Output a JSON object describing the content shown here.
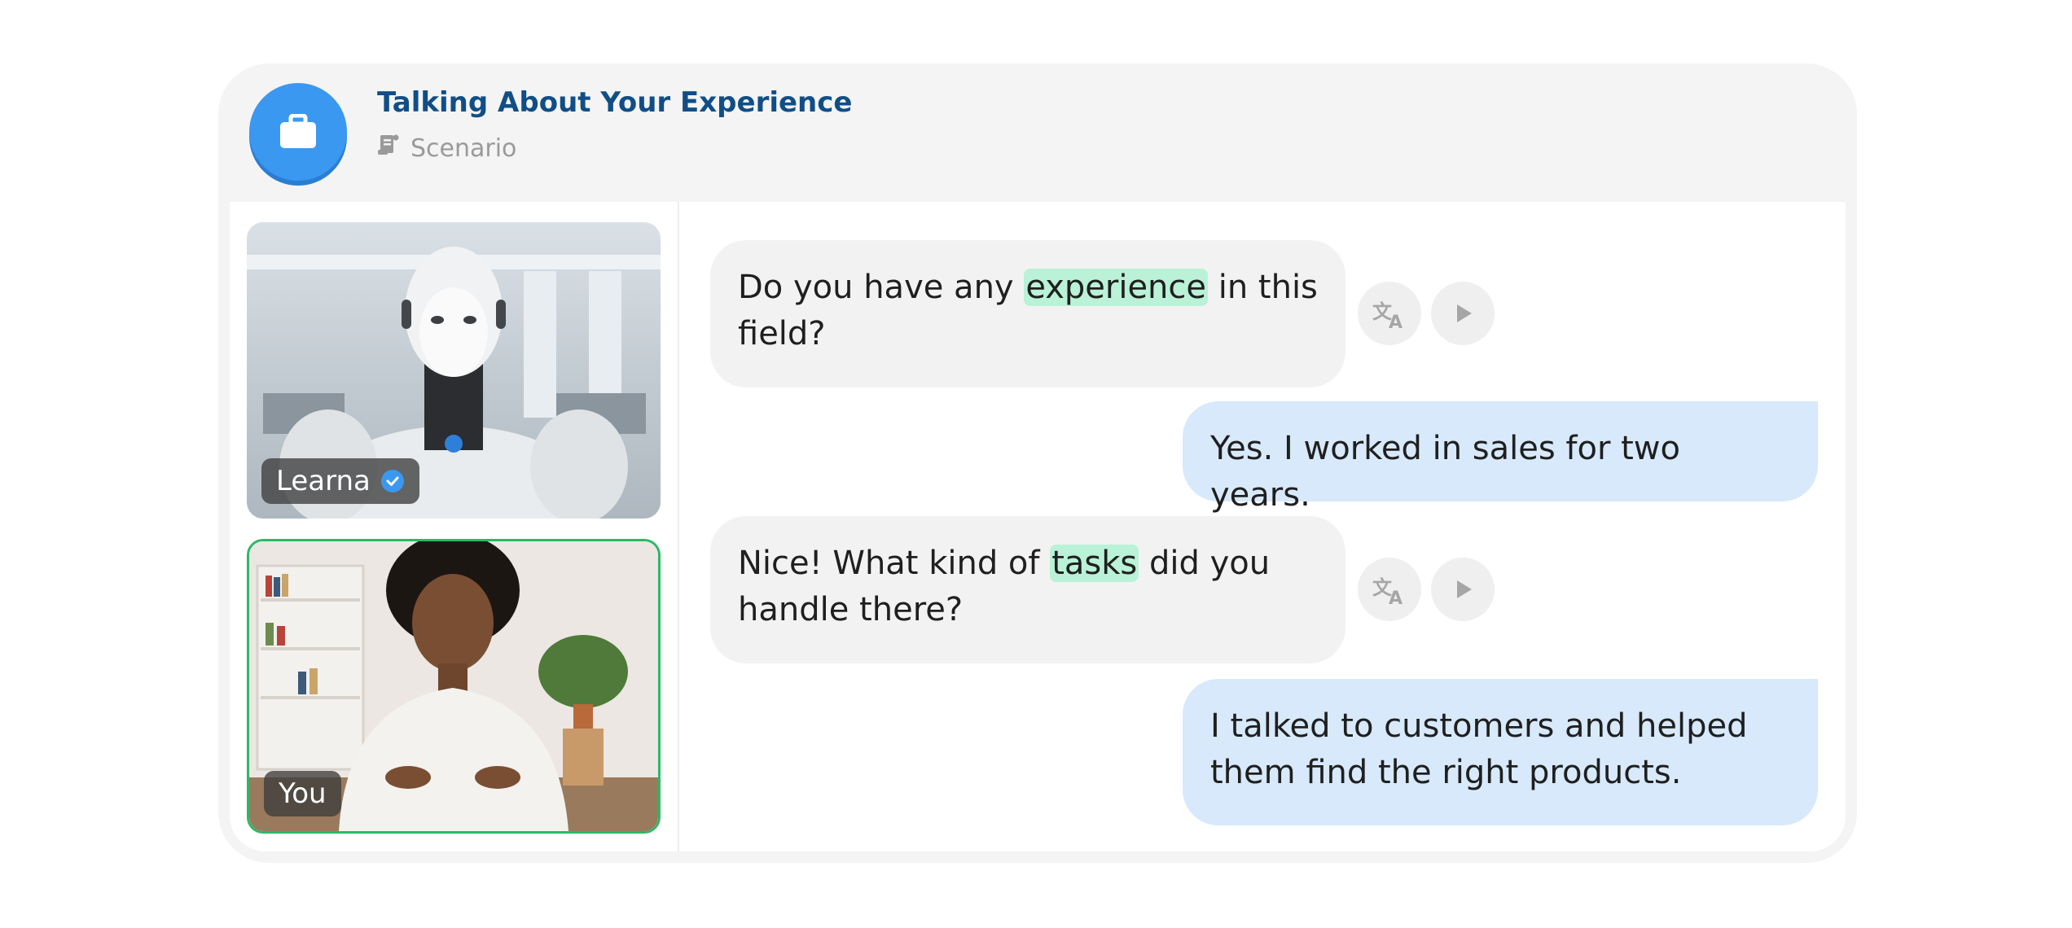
{
  "header": {
    "title": "Talking About Your Experience",
    "subtitle": "Scenario",
    "icon": "briefcase-icon",
    "subtitle_icon": "scroll-icon"
  },
  "participants": {
    "ai": {
      "name": "Learna",
      "badge_icon": "verified-check-icon"
    },
    "user": {
      "name": "You"
    }
  },
  "messages": [
    {
      "role": "ai",
      "before": "Do you have any ",
      "highlight": "experience",
      "after": " in this field?"
    },
    {
      "role": "user",
      "text": "Yes. I worked in sales for two years."
    },
    {
      "role": "ai",
      "before": "Nice! What kind of ",
      "highlight": "tasks",
      "after": " did you handle there?"
    },
    {
      "role": "user",
      "text": "I talked to customers and helped them find the right products."
    }
  ],
  "actions": {
    "translate_icon": "translate-icon",
    "play_icon": "play-icon"
  },
  "colors": {
    "accent": "#3a98f0",
    "title": "#114e86",
    "ai_bubble": "#f2f2f2",
    "user_bubble": "#d7e9fb",
    "highlight": "#b9f2d7",
    "user_video_border": "#2db866"
  }
}
